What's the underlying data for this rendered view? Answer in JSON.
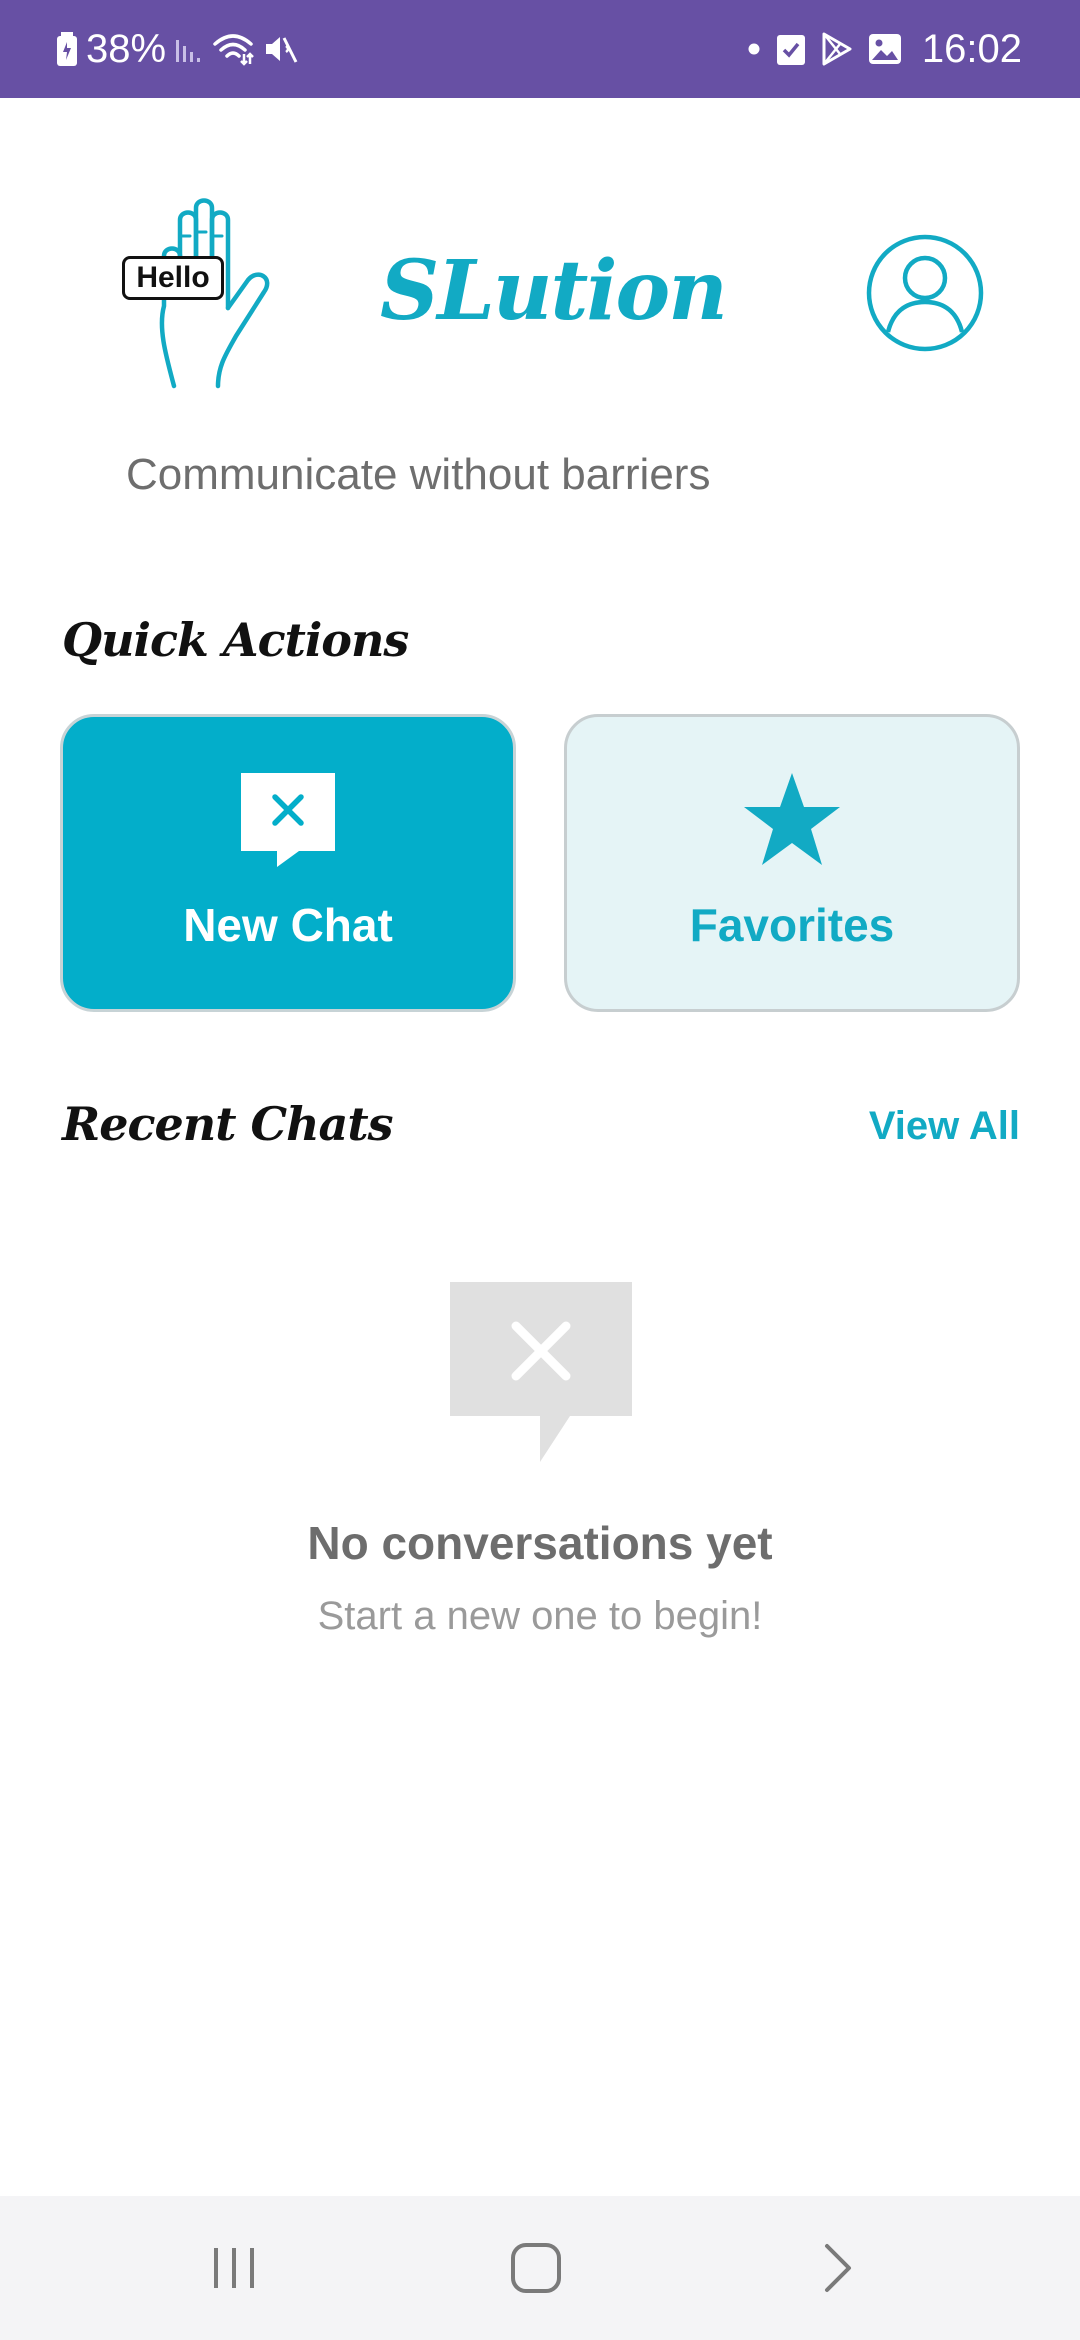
{
  "status_bar": {
    "battery": "38%",
    "time": "16:02",
    "left_icons": [
      "battery-saver-icon",
      "signal-icon",
      "wifi-icon",
      "vibrate-mute-icon"
    ],
    "right_icons": [
      "notification-dot-icon",
      "task-check-icon",
      "play-store-icon",
      "gallery-icon"
    ],
    "background": "#6750a4"
  },
  "header": {
    "logo_bubble": "Hello",
    "app_name": "SLution",
    "tagline": "Communicate without barriers",
    "profile_icon": "profile-icon"
  },
  "quick_actions": {
    "heading": "Quick Actions",
    "new_chat": {
      "label": "New Chat",
      "icon": "chat-icon"
    },
    "favorites": {
      "label": "Favorites",
      "icon": "star-icon"
    }
  },
  "recent_chats": {
    "heading": "Recent Chats",
    "view_all": "View All",
    "empty_title": "No conversations yet",
    "empty_subtitle": "Start a new one to begin!"
  },
  "nav_bar": {
    "buttons": [
      "recent-apps",
      "home",
      "back"
    ]
  },
  "colors": {
    "accent": "#12aac4",
    "card_primary": "#03aeca",
    "card_secondary": "#e5f4f6",
    "status_bar": "#6750a4"
  }
}
